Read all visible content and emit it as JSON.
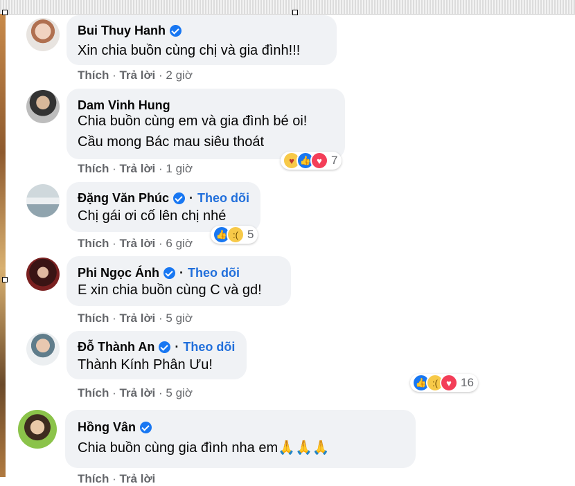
{
  "comments": [
    {
      "name": "Bui Thuy Hanh",
      "verified": true,
      "follow": "",
      "text": [
        "Xin chia buồn cùng chị và gia đình!!!"
      ],
      "like": "Thích",
      "reply": "Trả lời",
      "time": "2 giờ",
      "reactions": ""
    },
    {
      "name": "Dam Vinh Hung",
      "verified": false,
      "follow": "",
      "text": [
        "Chia buồn cùng em và gia đình bé oi!",
        "Cầu mong Bác mau siêu thoát"
      ],
      "like": "Thích",
      "reply": "Trả lời",
      "time": "1 giờ",
      "reactions": "7"
    },
    {
      "name": "Đặng Văn Phúc",
      "verified": true,
      "follow": "Theo dõi",
      "text": [
        "Chị gái ơi cố lên chị nhé"
      ],
      "like": "Thích",
      "reply": "Trả lời",
      "time": "6 giờ",
      "reactions": "5"
    },
    {
      "name": "Phi Ngọc Ánh",
      "verified": true,
      "follow": "Theo dõi",
      "text": [
        "E xin chia buồn cùng C và gd!"
      ],
      "like": "Thích",
      "reply": "Trả lời",
      "time": "5 giờ",
      "reactions": ""
    },
    {
      "name": "Đỗ Thành An",
      "verified": true,
      "follow": "Theo dõi",
      "text": [
        "Thành Kính Phân Ưu!"
      ],
      "like": "Thích",
      "reply": "Trả lời",
      "time": "5 giờ",
      "reactions": "16"
    },
    {
      "name": "Hồng Vân",
      "verified": true,
      "follow": "",
      "text": [
        "Chia buồn cùng gia đình nha em🙏🙏🙏"
      ],
      "like": "Thích",
      "reply": "Trả lời",
      "time": "",
      "reactions": ""
    }
  ],
  "separator": "·",
  "colors": {
    "bubble": "#f0f2f5",
    "verified": "#1877f2",
    "follow": "#216fdb",
    "meta": "#65676b"
  }
}
